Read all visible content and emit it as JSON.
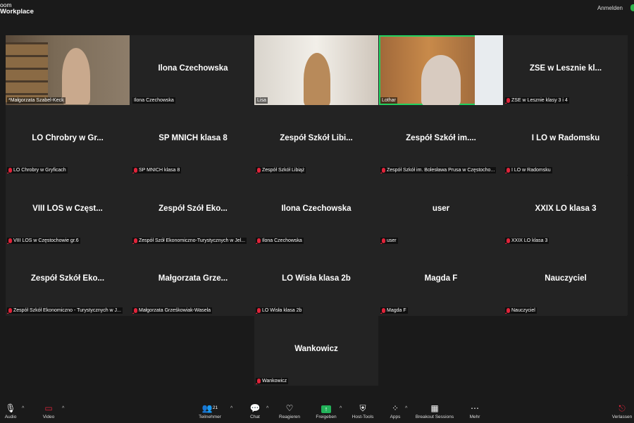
{
  "app": {
    "logo_line1": "oom",
    "logo_line2": "Workplace",
    "signin": "Anmelden"
  },
  "tiles": [
    {
      "name": "",
      "label": "*Małgorzata Szabel-Keck",
      "muted": false,
      "video": "vid1"
    },
    {
      "name": "Ilona Czechowska",
      "label": "Ilona Czechowska",
      "muted": false
    },
    {
      "name": "",
      "label": "Lisa",
      "muted": false,
      "video": "vid2"
    },
    {
      "name": "",
      "label": "Lothar",
      "muted": false,
      "video": "vid3",
      "active": true
    },
    {
      "name": "ZSE w Lesznie kl...",
      "label": "ZSE w Lesznie klasy 3 i 4",
      "muted": true
    },
    {
      "name": "LO Chrobry w Gr...",
      "label": "LO Chrobry w Gryficach",
      "muted": true
    },
    {
      "name": "SP MNICH klasa 8",
      "label": "SP MNICH klasa 8",
      "muted": true
    },
    {
      "name": "Zespół Szkół Libi...",
      "label": "Zespół Szkół Libiąż",
      "muted": true
    },
    {
      "name": "Zespół Szkół im....",
      "label": "Zespół Szkół im. Bolesława Prusa w Częstocho...",
      "muted": true
    },
    {
      "name": "I LO w Radomsku",
      "label": "I LO w Radomsku",
      "muted": true
    },
    {
      "name": "VIII LOS w Częst...",
      "label": "VIII LOS w Częstochowie gr.6",
      "muted": true
    },
    {
      "name": "Zespół Szół Eko...",
      "label": "Zespół Szół Ekonomiczno-Turystycznych w Jel...",
      "muted": true
    },
    {
      "name": "Ilona Czechowska",
      "label": "Ilona Czechowska",
      "muted": true
    },
    {
      "name": "user",
      "label": "user",
      "muted": true
    },
    {
      "name": "XXIX LO klasa 3",
      "label": "XXIX LO klasa 3",
      "muted": true
    },
    {
      "name": "Zespół Szkół Eko...",
      "label": "Zespół Szkół Ekonomiczno - Turystycznych w J...",
      "muted": true
    },
    {
      "name": "Małgorzata Grze...",
      "label": "Małgorzata Grześkowiak-Wasela",
      "muted": true
    },
    {
      "name": "LO Wisła klasa 2b",
      "label": "LO Wisła klasa 2b",
      "muted": true
    },
    {
      "name": "Magda F",
      "label": "Magda F",
      "muted": true
    },
    {
      "name": "Nauczyciel",
      "label": "Nauczyciel",
      "muted": true
    },
    {
      "name": "Wankowicz",
      "label": "Wankowicz",
      "muted": true
    }
  ],
  "toolbar": {
    "audio": "Audio",
    "video": "Video",
    "participants": "Teilnehmer",
    "participants_count": "21",
    "chat": "Chat",
    "react": "Reagieren",
    "share": "Freigeben",
    "host": "Host-Tools",
    "apps": "Apps",
    "breakout": "Breakout Sessions",
    "more": "Mehr",
    "leave": "Verlassen"
  },
  "colors": {
    "active_border": "#23d160",
    "muted_mic": "#e0243a",
    "share_green": "#23b35a",
    "leave_red": "#e0243a"
  }
}
